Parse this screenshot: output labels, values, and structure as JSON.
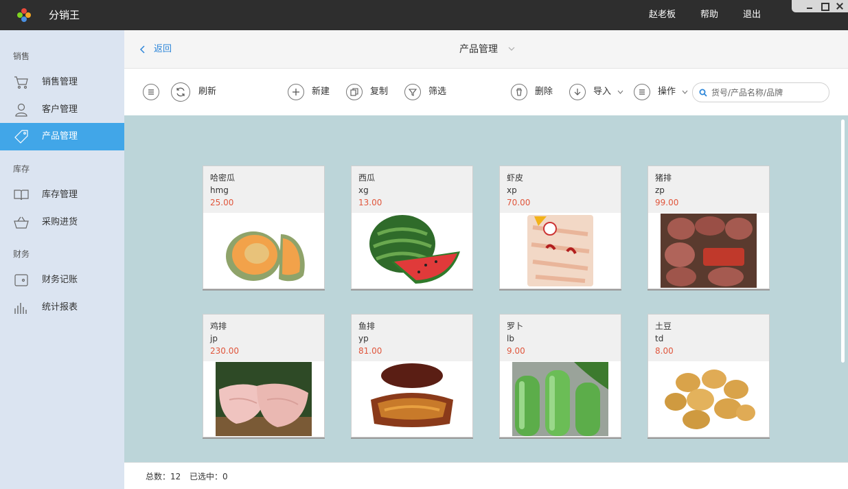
{
  "app": {
    "name": "分销王"
  },
  "topnav": {
    "user": "赵老板",
    "help": "帮助",
    "logout": "退出"
  },
  "sidebar": {
    "sections": [
      "销售",
      "库存",
      "财务"
    ],
    "items": [
      {
        "label": "销售管理",
        "icon": "cart-icon"
      },
      {
        "label": "客户管理",
        "icon": "user-icon"
      },
      {
        "label": "产品管理",
        "icon": "tag-icon"
      },
      {
        "label": "库存管理",
        "icon": "book-icon"
      },
      {
        "label": "采购进货",
        "icon": "basket-icon"
      },
      {
        "label": "财务记账",
        "icon": "wallet-icon"
      },
      {
        "label": "统计报表",
        "icon": "bar-chart-icon"
      }
    ],
    "active_color": "#41a6e8"
  },
  "header": {
    "back": "返回",
    "title": "产品管理"
  },
  "toolbar": {
    "refresh": "刷新",
    "new": "新建",
    "copy": "复制",
    "filter": "筛选",
    "delete": "删除",
    "import": "导入",
    "actions": "操作",
    "search_placeholder": "货号/产品名称/品牌"
  },
  "products": [
    {
      "name": "哈密瓜",
      "code": "hmg",
      "price": "25.00",
      "image": "cantaloupe"
    },
    {
      "name": "西瓜",
      "code": "xg",
      "price": "13.00",
      "image": "watermelon"
    },
    {
      "name": "虾皮",
      "code": "xp",
      "price": "70.00",
      "image": "dried-shrimp"
    },
    {
      "name": "猪排",
      "code": "zp",
      "price": "99.00",
      "image": "pork-chop"
    },
    {
      "name": "鸡排",
      "code": "jp",
      "price": "230.00",
      "image": "chicken-breast"
    },
    {
      "name": "鱼排",
      "code": "yp",
      "price": "81.00",
      "image": "fish-steak"
    },
    {
      "name": "罗卜",
      "code": "lb",
      "price": "9.00",
      "image": "radish"
    },
    {
      "name": "土豆",
      "code": "td",
      "price": "8.00",
      "image": "potato"
    }
  ],
  "footer": {
    "total_label": "总数：12",
    "selected_label": "已选中：0"
  },
  "colors": {
    "price": "#e0553b",
    "content_bg": "#bcd5d9",
    "link": "#2d86d9"
  }
}
